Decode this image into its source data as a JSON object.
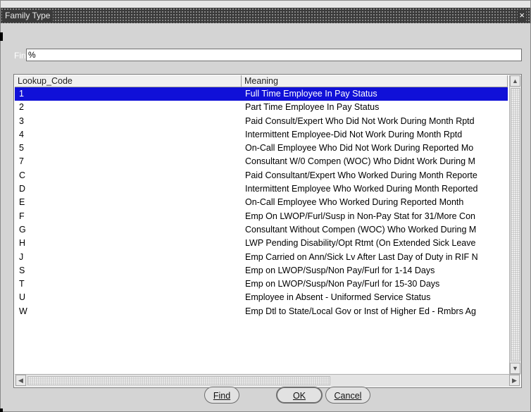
{
  "window": {
    "title": "Family Type",
    "close_glyph": "×"
  },
  "search": {
    "label": "Find",
    "value": "%"
  },
  "table": {
    "columns": [
      "Lookup_Code",
      "Meaning"
    ],
    "selected_index": 0,
    "rows": [
      {
        "code": "1",
        "meaning": "Full Time Employee In Pay Status"
      },
      {
        "code": "2",
        "meaning": "Part Time Employee In Pay Status"
      },
      {
        "code": "3",
        "meaning": "Paid Consult/Expert Who Did Not Work During Month Rptd"
      },
      {
        "code": "4",
        "meaning": "Intermittent Employee-Did Not Work During Month Rptd"
      },
      {
        "code": "5",
        "meaning": "On-Call Employee Who Did Not Work During Reported Mo"
      },
      {
        "code": "7",
        "meaning": "Consultant W/0 Compen (WOC) Who Didnt Work During M"
      },
      {
        "code": "C",
        "meaning": "Paid Consultant/Expert Who Worked During Month Reporte"
      },
      {
        "code": "D",
        "meaning": "Intermittent Employee Who Worked During Month Reported"
      },
      {
        "code": "E",
        "meaning": "On-Call Employee Who Worked During Reported Month"
      },
      {
        "code": "F",
        "meaning": "Emp On LWOP/Furl/Susp in Non-Pay Stat for 31/More Con"
      },
      {
        "code": "G",
        "meaning": "Consultant Without Compen (WOC) Who Worked During M"
      },
      {
        "code": "H",
        "meaning": "LWP Pending Disability/Opt Rtmt (On Extended Sick Leave"
      },
      {
        "code": "J",
        "meaning": "Emp Carried on Ann/Sick Lv After Last Day of Duty in RIF N"
      },
      {
        "code": "S",
        "meaning": "Emp on LWOP/Susp/Non Pay/Furl for 1-14 Days"
      },
      {
        "code": "T",
        "meaning": "Emp on LWOP/Susp/Non Pay/Furl for 15-30 Days"
      },
      {
        "code": "U",
        "meaning": "Employee in Absent - Uniformed Service Status"
      },
      {
        "code": "W",
        "meaning": "Emp Dtl to State/Local Gov or Inst of Higher Ed - Rmbrs Ag"
      }
    ]
  },
  "buttons": {
    "find_label": "Find",
    "ok_label": "OK",
    "cancel_label": "Cancel"
  },
  "colors": {
    "selection": "#1010d8",
    "titlebar": "#3a3a3a",
    "dialog_bg": "#d4d4d4"
  },
  "icons": {
    "close": "close-icon",
    "scroll_up": "chevron-up-icon",
    "scroll_down": "chevron-down-icon",
    "scroll_left": "chevron-left-icon",
    "scroll_right": "chevron-right-icon"
  }
}
